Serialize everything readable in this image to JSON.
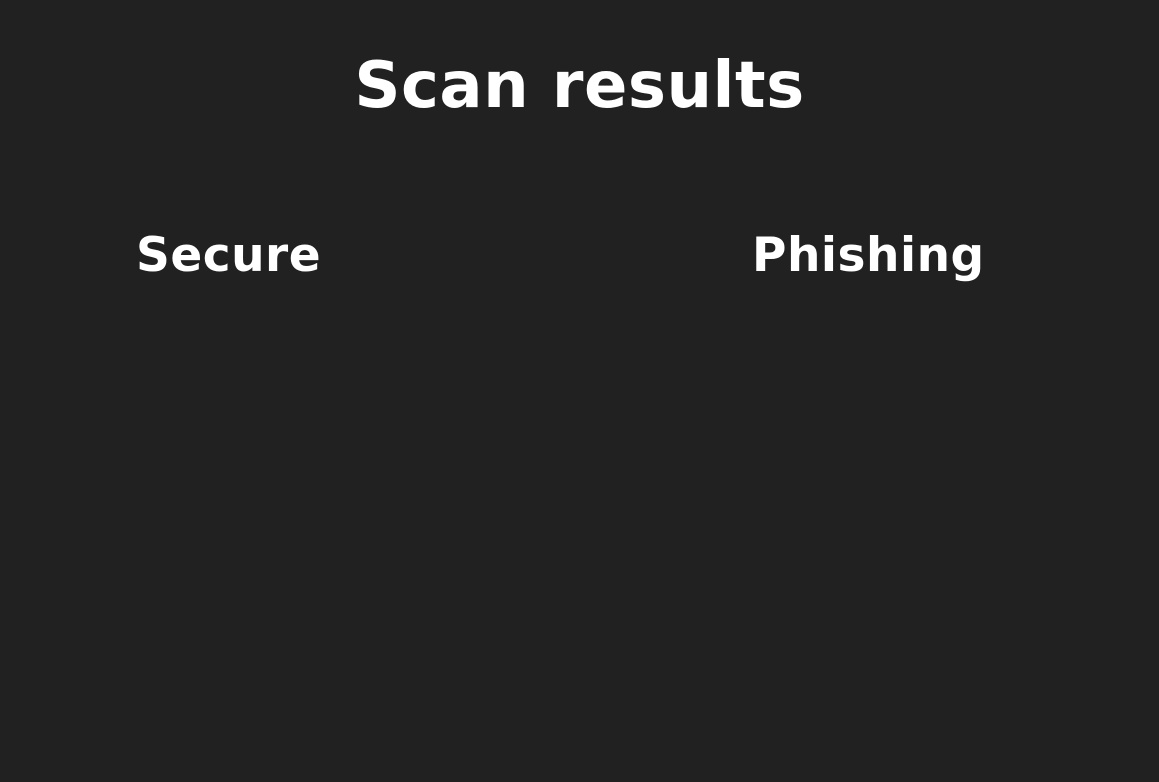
{
  "page": {
    "title": "Scan results",
    "background_color": "#212121",
    "text_color": "#ffffff"
  },
  "columns": {
    "secure": {
      "heading": "Secure",
      "items": []
    },
    "phishing": {
      "heading": "Phishing",
      "items": []
    }
  }
}
